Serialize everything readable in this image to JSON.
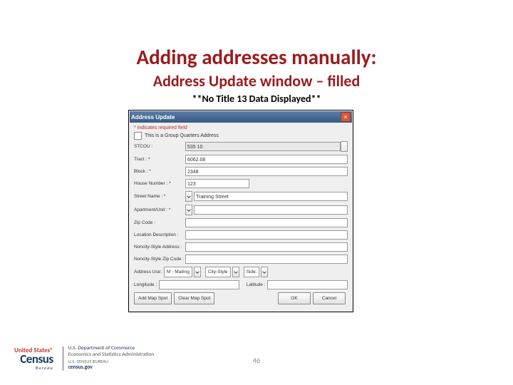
{
  "title": "Adding addresses manually:",
  "subtitle": "Address Update window – filled",
  "note": "**No Title 13 Data Displayed**",
  "window": {
    "title": "Address Update",
    "required_hint": "* indicates required field",
    "gq_label": "This is a Group Quarters Address",
    "fields": {
      "stcou": {
        "label": "STCOU :",
        "value": "535 10"
      },
      "tract": {
        "label": "Tract : *",
        "value": "6062.08"
      },
      "block": {
        "label": "Block : *",
        "value": "2348"
      },
      "houseno": {
        "label": "House Number : *",
        "value": "123"
      },
      "street": {
        "label": "Street Name : *",
        "value": "Training Street"
      },
      "apt": {
        "label": "Apartment/Unit : *",
        "value": ""
      },
      "zip": {
        "label": "Zip Code :",
        "value": ""
      },
      "locdesc": {
        "label": "Location Description :",
        "value": ""
      },
      "nonstyle": {
        "label": "Noncity-Style Address :",
        "value": ""
      },
      "nonzip": {
        "label": "Noncity-Style Zip Code :",
        "value": ""
      }
    },
    "address_use": {
      "label": "Address Use:",
      "m": {
        "label": "M - Mailing",
        "value": ""
      },
      "cs": {
        "label": "City-Style",
        "value": ""
      },
      "side": {
        "label": "Side:",
        "value": ""
      }
    },
    "latlon": {
      "long_label": "Longitude :",
      "lat_label": "Latitude :",
      "long_value": "",
      "lat_value": ""
    },
    "buttons": {
      "addspot": "Add Map Spot",
      "clearspot": "Clear Map Spot",
      "ok": "OK",
      "cancel": "Cancel"
    }
  },
  "footer": {
    "us": "United States®",
    "census": "Census",
    "bureau": "Bureau",
    "d1": "U.S. Department of Commerce",
    "d2": "Economics and Statistics Administration",
    "d3": "U.S. CENSUS BUREAU",
    "d4": "census.gov"
  },
  "page_number": "46"
}
